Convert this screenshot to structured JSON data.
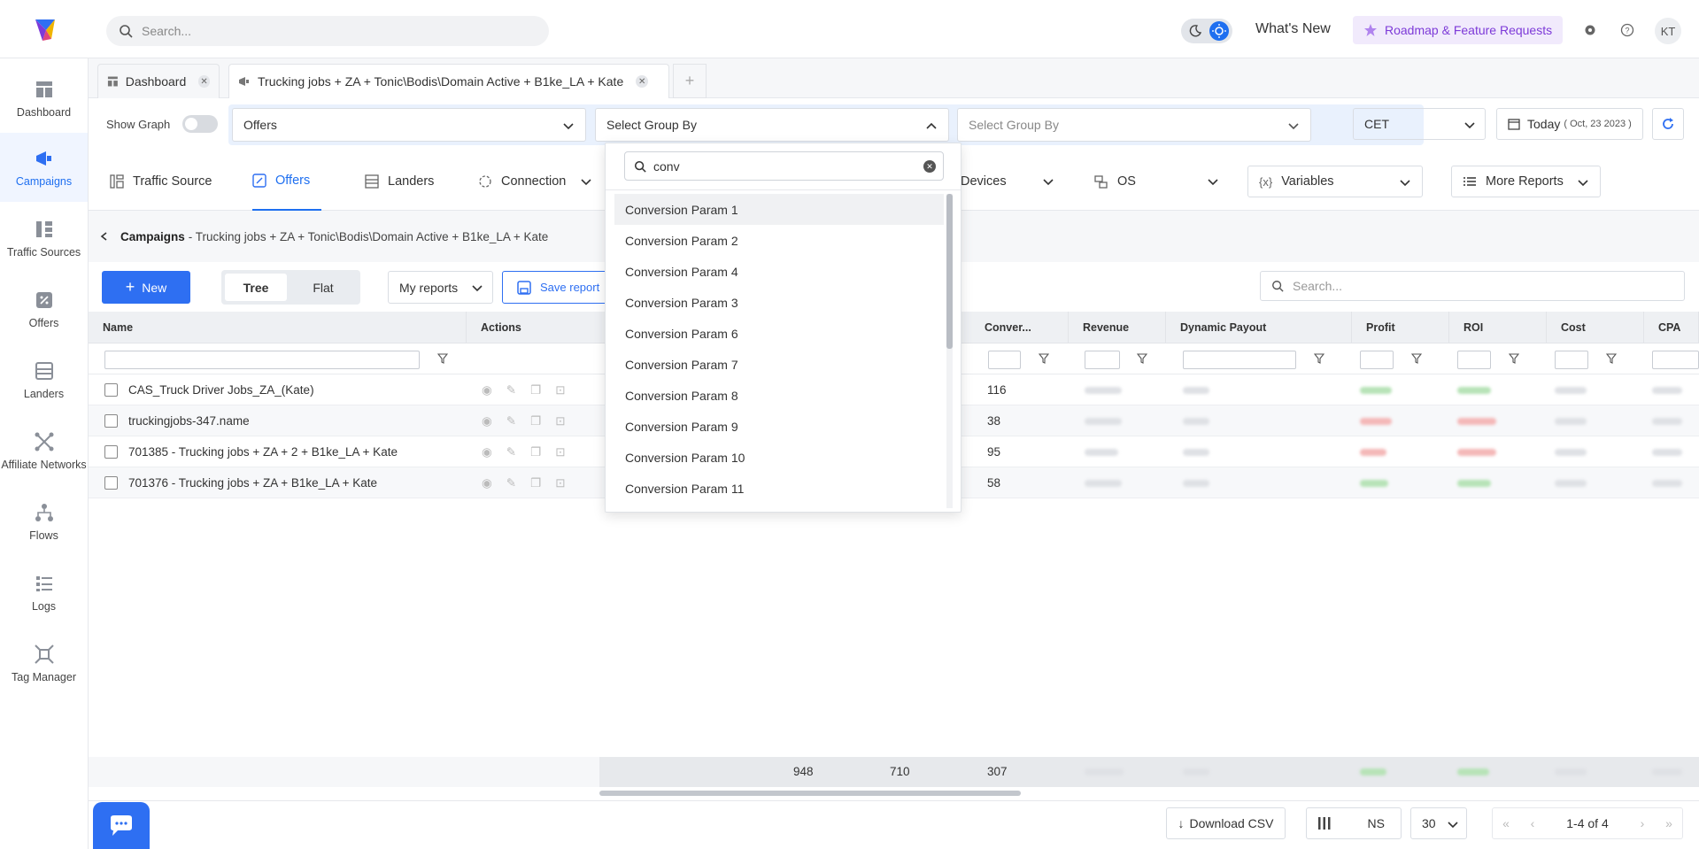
{
  "header": {
    "search_placeholder": "Search...",
    "whats_new": "What's New",
    "roadmap": "Roadmap & Feature Requests",
    "avatar_initials": "KT"
  },
  "sidebar": {
    "items": [
      {
        "label": "Dashboard",
        "icon": "dashboard-icon"
      },
      {
        "label": "Campaigns",
        "icon": "megaphone-icon",
        "active": true
      },
      {
        "label": "Traffic Sources",
        "icon": "traffic-sources-icon"
      },
      {
        "label": "Offers",
        "icon": "offers-icon"
      },
      {
        "label": "Landers",
        "icon": "landers-icon"
      },
      {
        "label": "Affiliate Networks",
        "icon": "network-icon"
      },
      {
        "label": "Flows",
        "icon": "flows-icon"
      },
      {
        "label": "Logs",
        "icon": "logs-icon"
      },
      {
        "label": "Tag Manager",
        "icon": "tag-manager-icon"
      }
    ]
  },
  "tabs": [
    {
      "label": "Dashboard"
    },
    {
      "label": "Trucking jobs + ZA + Tonic\\Bodis\\Domain Active + B1ke_LA + Kate"
    }
  ],
  "filters": {
    "show_graph": "Show Graph",
    "group1": "Offers",
    "group2": "Select Group By",
    "group3": "Select Group By",
    "timezone": "CET",
    "date": "Today",
    "date_detail": "( Oct, 23 2023 )"
  },
  "report_tabs": {
    "traffic_source": "Traffic Source",
    "offers": "Offers",
    "landers": "Landers",
    "connection": "Connection",
    "devices": "Devices",
    "os": "OS",
    "variables": "Variables",
    "more_reports": "More Reports"
  },
  "breadcrumb": {
    "root": "Campaigns",
    "rest": "- Trucking jobs + ZA + Tonic\\Bodis\\Domain Active + B1ke_LA + Kate"
  },
  "toolbar": {
    "new": "New",
    "tree": "Tree",
    "flat": "Flat",
    "my_reports": "My reports",
    "save_report": "Save report",
    "search_placeholder": "Search..."
  },
  "table": {
    "columns": {
      "name": "Name",
      "actions": "Actions",
      "conversions": "Conver...",
      "revenue": "Revenue",
      "dynamic_payout": "Dynamic Payout",
      "profit": "Profit",
      "roi": "ROI",
      "cost": "Cost",
      "cpa": "CPA"
    },
    "rows": [
      {
        "name": "CAS_Truck Driver Jobs_ZA_(Kate)",
        "conversions": "116"
      },
      {
        "name": "truckingjobs-347.name",
        "conversions": "38"
      },
      {
        "name": "701385 - Trucking jobs + ZA + 2 + B1ke_LA + Kate",
        "conversions": "95"
      },
      {
        "name": "701376 - Trucking jobs + ZA + B1ke_LA + Kate",
        "conversions": "58"
      }
    ],
    "totals": [
      "948",
      "710",
      "307"
    ]
  },
  "footer": {
    "download_csv": "Download CSV",
    "columns_label": "NS",
    "per_page": "30",
    "page_info": "1-4 of 4"
  },
  "dropdown": {
    "search_value": "conv",
    "items": [
      "Conversion Param 1",
      "Conversion Param 2",
      "Conversion Param 4",
      "Conversion Param 3",
      "Conversion Param 6",
      "Conversion Param 7",
      "Conversion Param 8",
      "Conversion Param 9",
      "Conversion Param 10",
      "Conversion Param 11"
    ]
  },
  "colors": {
    "accent": "#2e6ff2",
    "roadmap_text": "#7d3ad8",
    "roadmap_bg": "#f1eafc"
  }
}
